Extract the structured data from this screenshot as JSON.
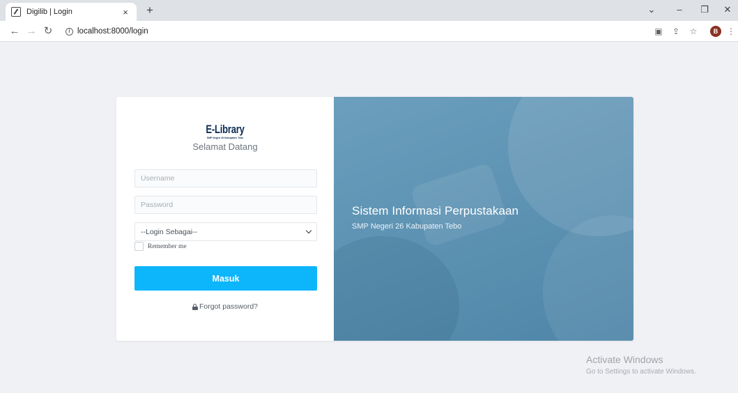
{
  "browser": {
    "tab_title": "Digilib | Login",
    "tab_close": "×",
    "new_tab": "+",
    "url": "localhost:8000/login",
    "profile_initial": "B",
    "window_controls": {
      "minimize": "–",
      "restore": "❐",
      "close": "✕",
      "tab_search": "⌄"
    }
  },
  "login": {
    "logo_text": "E-Library",
    "logo_subtext": "SMP Negeri 26 Kabupaten Tebo",
    "welcome": "Selamat Datang",
    "username_placeholder": "Username",
    "password_placeholder": "Password",
    "role_select_value": "--Login Sebagai--",
    "remember_label": "Remember me",
    "submit_label": "Masuk",
    "forgot_label": "Forgot password?"
  },
  "hero": {
    "title": "Sistem Informasi Perpustakaan",
    "subtitle": "SMP Negeri 26 Kabupaten Tebo"
  },
  "watermark": {
    "title": "Activate Windows",
    "subtitle": "Go to Settings to activate Windows."
  },
  "colors": {
    "accent": "#0db5fb",
    "hero": "#5e93b3",
    "page_bg": "#f0f1f5"
  }
}
